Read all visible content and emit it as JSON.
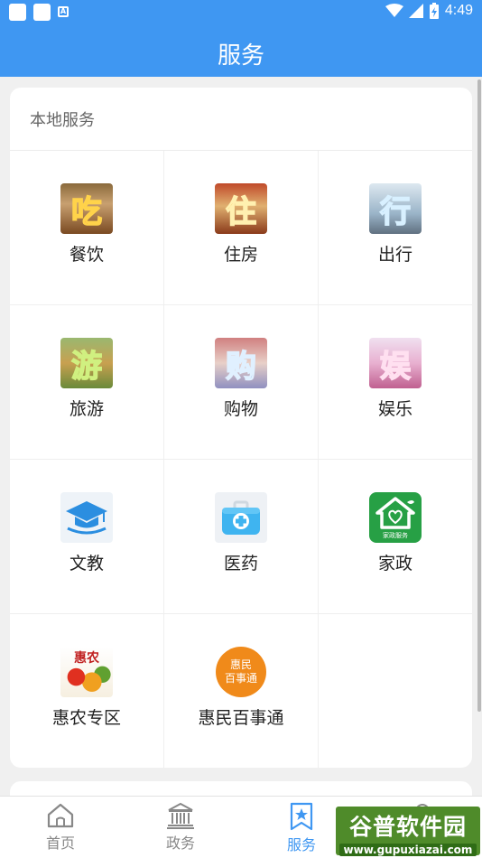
{
  "status_bar": {
    "time": "4:49"
  },
  "header": {
    "title": "服务"
  },
  "section": {
    "title": "本地服务",
    "items": [
      {
        "label": "餐饮",
        "glyph": "吃",
        "icon": "dining-icon"
      },
      {
        "label": "住房",
        "glyph": "住",
        "icon": "housing-icon"
      },
      {
        "label": "出行",
        "glyph": "行",
        "icon": "travel-icon"
      },
      {
        "label": "旅游",
        "glyph": "游",
        "icon": "tourism-icon"
      },
      {
        "label": "购物",
        "glyph": "购",
        "icon": "shopping-icon"
      },
      {
        "label": "娱乐",
        "glyph": "娱",
        "icon": "entertainment-icon"
      },
      {
        "label": "文教",
        "icon": "graduation-cap-icon"
      },
      {
        "label": "医药",
        "icon": "medical-kit-icon"
      },
      {
        "label": "家政",
        "icon": "housekeeping-icon",
        "sublabel": "家政服务"
      },
      {
        "label": "惠农专区",
        "glyph": "惠农",
        "icon": "agriculture-icon"
      },
      {
        "label": "惠民百事通",
        "icon": "huimin-icon",
        "badge_line1": "惠民",
        "badge_line2": "百事通"
      }
    ]
  },
  "tabs": [
    {
      "label": "首页",
      "icon": "home-icon"
    },
    {
      "label": "政务",
      "icon": "government-icon"
    },
    {
      "label": "服务",
      "icon": "star-bookmark-icon",
      "active": true
    },
    {
      "label": "",
      "icon": "profile-icon"
    }
  ],
  "watermark": {
    "brand": "谷普软件园",
    "url": "www.gupuxiazai.com"
  },
  "colors": {
    "primary": "#3f97f2",
    "card": "#ffffff",
    "background": "#f0f0f0"
  }
}
